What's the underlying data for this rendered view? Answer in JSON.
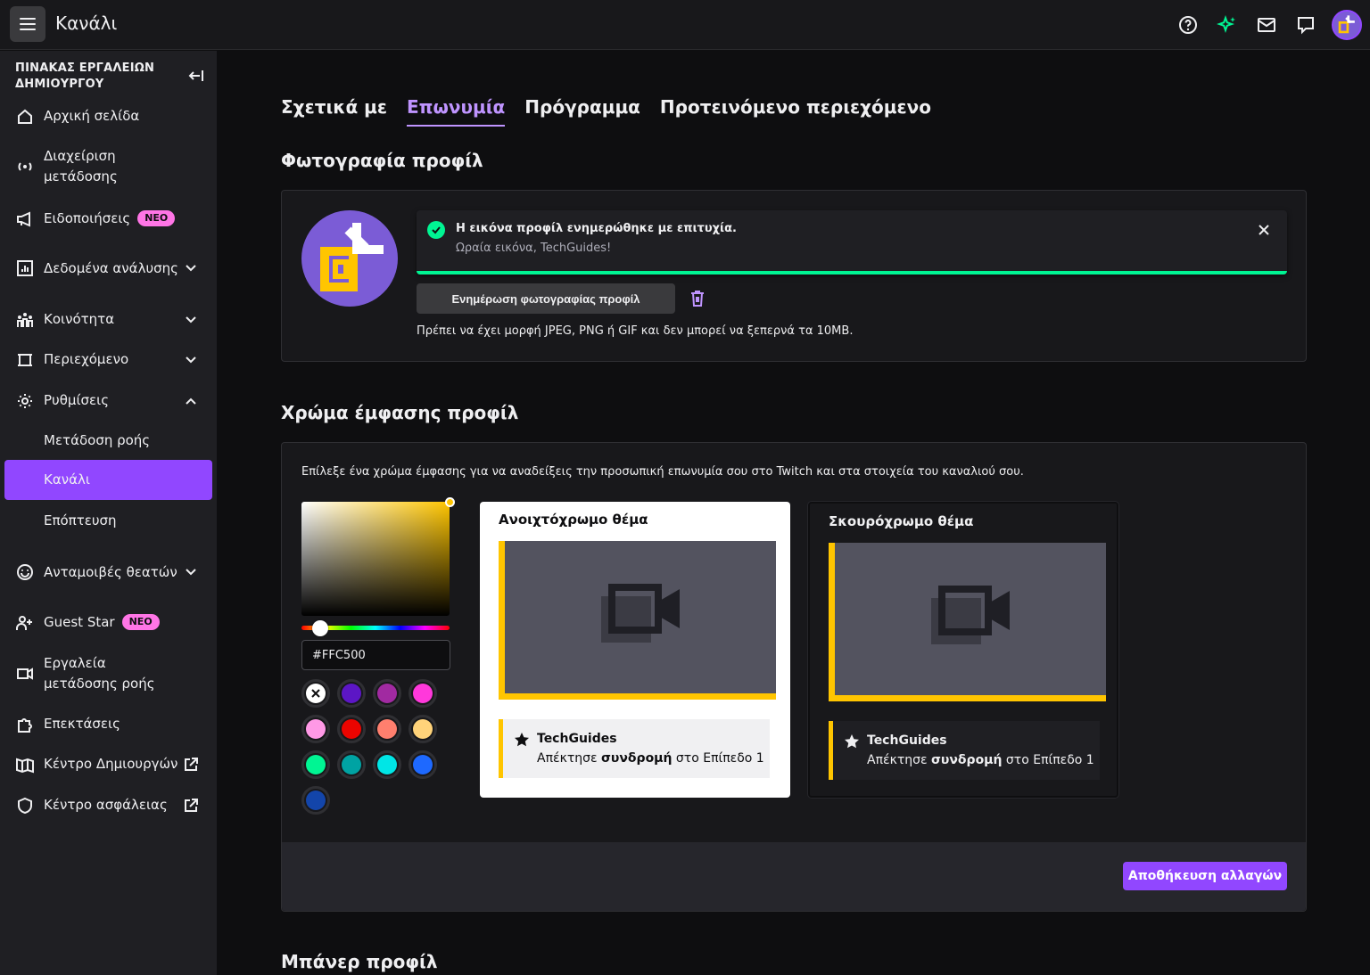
{
  "app": {
    "title": "Κανάλι"
  },
  "sidebar": {
    "header": "ΠΙΝΑΚΑΣ ΕΡΓΑΛΕΙΩΝ ΔΗΜΙΟΥΡΓΟΥ",
    "items": [
      {
        "label": "Αρχική σελίδα"
      },
      {
        "label": "Διαχείριση μετάδοσης"
      },
      {
        "label": "Ειδοποιήσεις",
        "badge": "ΝΕΟ"
      },
      {
        "label": "Δεδομένα ανάλυσης"
      },
      {
        "label": "Κοινότητα"
      },
      {
        "label": "Περιεχόμενο"
      },
      {
        "label": "Ρυθμίσεις"
      },
      {
        "label": "Μετάδοση ροής"
      },
      {
        "label": "Κανάλι"
      },
      {
        "label": "Επόπτευση"
      },
      {
        "label": "Ανταμοιβές θεατών"
      },
      {
        "label": "Guest Star",
        "badge": "ΝΕΟ"
      },
      {
        "label": "Εργαλεία μετάδοσης ροής"
      },
      {
        "label": "Επεκτάσεις"
      },
      {
        "label": "Κέντρο Δημιουργών"
      },
      {
        "label": "Κέντρο ασφάλειας"
      }
    ]
  },
  "tabs": [
    {
      "label": "Σχετικά με"
    },
    {
      "label": "Επωνυμία"
    },
    {
      "label": "Πρόγραμμα"
    },
    {
      "label": "Προτεινόμενο περιεχόμενο"
    }
  ],
  "profile_photo": {
    "title": "Φωτογραφία προφίλ",
    "toast_title": "Η εικόνα προφίλ ενημερώθηκε με επιτυχία.",
    "toast_sub": "Ωραία εικόνα, TechGuides!",
    "update_button": "Ενημέρωση φωτογραφίας προφίλ",
    "hint": "Πρέπει να έχει μορφή JPEG, PNG ή GIF και δεν μπορεί να ξεπερνά τα 10MB."
  },
  "accent": {
    "title": "Χρώμα έμφασης προφίλ",
    "description": "Επίλεξε ένα χρώμα έμφασης για να αναδείξεις την προσωπική επωνυμία σου στο Twitch και στα στοιχεία του καναλιού σου.",
    "hex_value": "#FFC500",
    "swatches": [
      "none",
      "#5c16c5",
      "#a12aa1",
      "#ff38db",
      "#ff99e6",
      "#eb0400",
      "#ff7f6e",
      "#ffd37a",
      "#00f593",
      "#00a3a3",
      "#00e6e6",
      "#1e69ff",
      "#1345aa"
    ],
    "light_theme_label": "Ανοιχτόχρωμο θέμα",
    "dark_theme_label": "Σκουρόχρωμο θέμα",
    "notif_name": "TechGuides",
    "notif_pre": "Απέκτησε ",
    "notif_bold": "συνδρομή",
    "notif_post": " στο Επίπεδο 1",
    "save_button": "Αποθήκευση αλλαγών"
  },
  "banner": {
    "title": "Μπάνερ προφίλ"
  },
  "colors": {
    "accent": "#9147ff",
    "accent_text": "#bf94ff",
    "success": "#00f593",
    "selected_accent": "#FFC500"
  }
}
